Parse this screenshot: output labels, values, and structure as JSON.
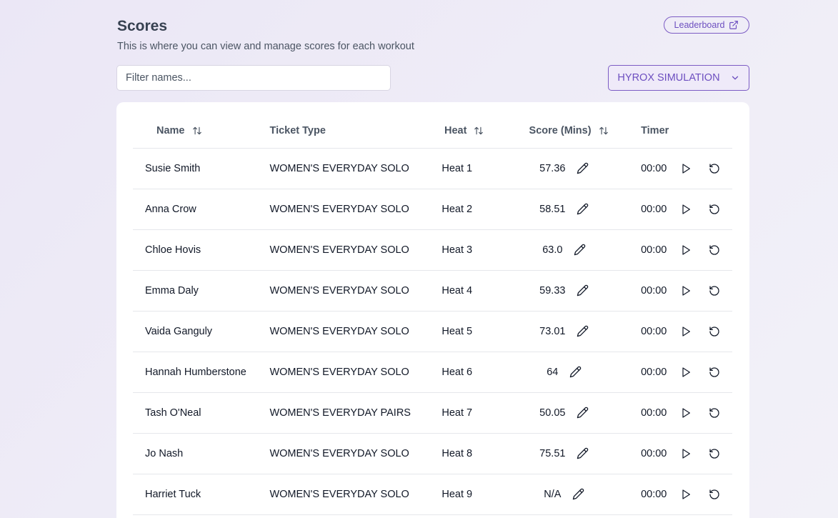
{
  "header": {
    "title": "Scores",
    "subtitle": "This is where you can view and manage scores for each workout",
    "leaderboard_label": "Leaderboard"
  },
  "filter": {
    "placeholder": "Filter names...",
    "value": ""
  },
  "workout_select": {
    "selected": "HYROX SIMULATION"
  },
  "table": {
    "columns": {
      "name": "Name",
      "ticket_type": "Ticket Type",
      "heat": "Heat",
      "score": "Score (Mins)",
      "timer": "Timer"
    },
    "rows": [
      {
        "name": "Susie Smith",
        "ticket_type": "WOMEN'S EVERYDAY SOLO",
        "heat": "Heat 1",
        "score": "57.36",
        "timer": "00:00"
      },
      {
        "name": "Anna Crow",
        "ticket_type": "WOMEN'S EVERYDAY SOLO",
        "heat": "Heat 2",
        "score": "58.51",
        "timer": "00:00"
      },
      {
        "name": "Chloe Hovis",
        "ticket_type": "WOMEN'S EVERYDAY SOLO",
        "heat": "Heat 3",
        "score": "63.0",
        "timer": "00:00"
      },
      {
        "name": "Emma Daly",
        "ticket_type": "WOMEN'S EVERYDAY SOLO",
        "heat": "Heat 4",
        "score": "59.33",
        "timer": "00:00"
      },
      {
        "name": "Vaida Ganguly",
        "ticket_type": "WOMEN'S EVERYDAY SOLO",
        "heat": "Heat 5",
        "score": "73.01",
        "timer": "00:00"
      },
      {
        "name": "Hannah Humberstone",
        "ticket_type": "WOMEN'S EVERYDAY SOLO",
        "heat": "Heat 6",
        "score": "64",
        "timer": "00:00"
      },
      {
        "name": "Tash O'Neal",
        "ticket_type": "WOMEN'S EVERYDAY PAIRS",
        "heat": "Heat 7",
        "score": "50.05",
        "timer": "00:00"
      },
      {
        "name": "Jo Nash",
        "ticket_type": "WOMEN'S EVERYDAY SOLO",
        "heat": "Heat 8",
        "score": "75.51",
        "timer": "00:00"
      },
      {
        "name": "Harriet Tuck",
        "ticket_type": "WOMEN'S EVERYDAY SOLO",
        "heat": "Heat 9",
        "score": "N/A",
        "timer": "00:00"
      }
    ]
  },
  "icons": {
    "leaderboard": "external-link-icon",
    "select": "chevron-down-icon",
    "sort": "sort-arrows-icon",
    "edit": "pencil-icon",
    "play": "play-icon",
    "reset": "reset-icon"
  },
  "colors": {
    "accent": "#6d4fc0",
    "background": "#ebe7f6"
  }
}
